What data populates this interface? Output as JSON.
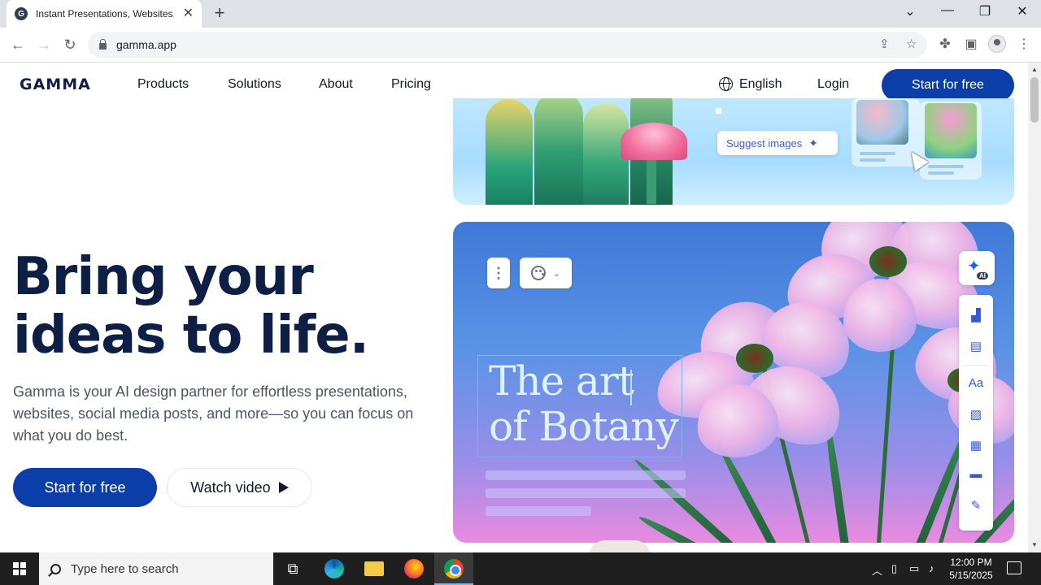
{
  "browser": {
    "tab_title": "Instant Presentations, Websites,",
    "favicon_letter": "G",
    "url": "gamma.app"
  },
  "nav": {
    "logo": "GAMMA",
    "links": [
      "Products",
      "Solutions",
      "About",
      "Pricing"
    ],
    "language": "English",
    "login": "Login",
    "cta": "Start for free"
  },
  "hero": {
    "title_line1": "Bring your",
    "title_line2": "ideas to life.",
    "subtitle": "Gamma is your AI design partner for effortless presentations, websites, social media posts, and more—so you can focus on what you do best.",
    "primary_cta": "Start for free",
    "secondary_cta": "Watch video"
  },
  "preview": {
    "suggest_images": "Suggest images",
    "slide_title_line1": "The art",
    "slide_title_line2": "of Botany",
    "ai_badge": "AI",
    "font_icon_label": "Aa"
  },
  "taskbar": {
    "search_placeholder": "Type here to search",
    "time": "12:00 PM",
    "date": "5/15/2025"
  },
  "colors": {
    "brand_blue": "#0b3ea8",
    "headline": "#0e1f45"
  }
}
